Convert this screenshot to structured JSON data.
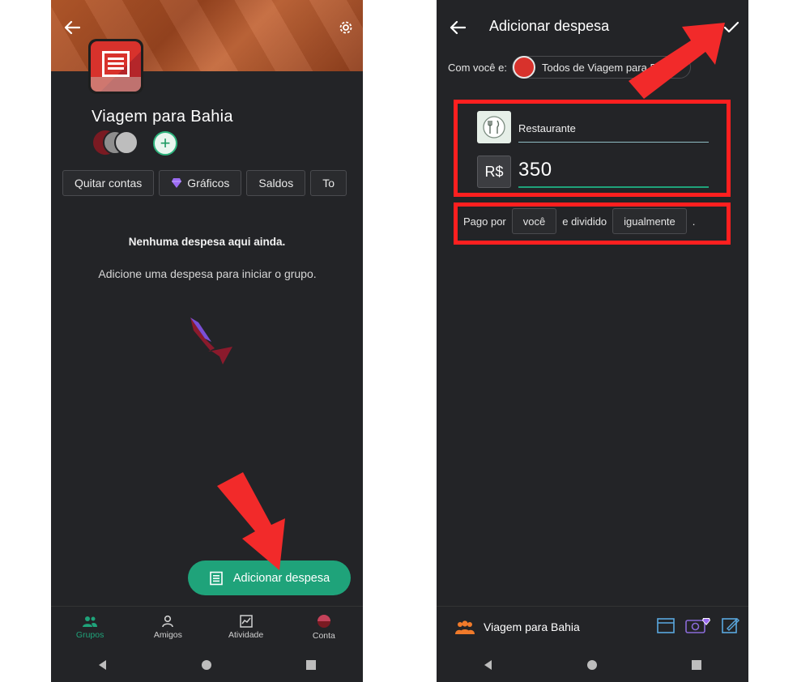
{
  "left": {
    "group_title": "Viagem para Bahia",
    "add_member_symbol": "+",
    "chips": [
      {
        "label": "Quitar contas",
        "icon": null
      },
      {
        "label": "Gráficos",
        "icon": "gem-icon"
      },
      {
        "label": "Saldos",
        "icon": null
      },
      {
        "label": "To",
        "icon": null
      }
    ],
    "empty_title": "Nenhuma despesa aqui ainda.",
    "empty_subtitle": "Adicione uma despesa para iniciar o grupo.",
    "fab_label": "Adicionar despesa",
    "nav": [
      {
        "label": "Grupos",
        "icon": "groups-icon",
        "active": true
      },
      {
        "label": "Amigos",
        "icon": "person-icon",
        "active": false
      },
      {
        "label": "Atividade",
        "icon": "activity-icon",
        "active": false
      },
      {
        "label": "Conta",
        "icon": "account-icon",
        "active": false
      }
    ]
  },
  "right": {
    "title": "Adicionar despesa",
    "with_label": "Com você e:",
    "with_group": "Todos de Viagem para Bahia",
    "category": "Restaurante",
    "currency": "R$",
    "amount": "350",
    "paid_by_label": "Pago por",
    "payer": "você",
    "split_label": "e dividido",
    "split_mode": "igualmente",
    "period": ".",
    "footer_group": "Viagem para Bahia"
  },
  "colors": {
    "accent_green": "#1fa37a",
    "highlight_red": "#ff1f1f",
    "background_dark": "#232427",
    "cover_brown": "#b75a2b"
  }
}
